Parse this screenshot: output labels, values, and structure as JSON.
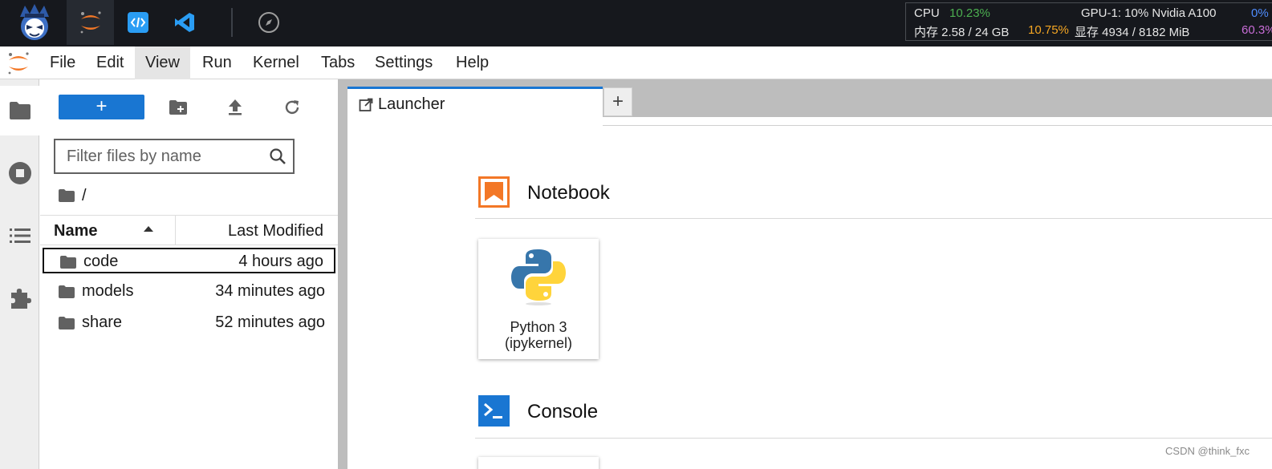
{
  "topbar": {
    "apps": [
      {
        "name": "user-avatar"
      },
      {
        "name": "jupyter-app"
      },
      {
        "name": "code-server-app"
      },
      {
        "name": "vscode-app"
      },
      {
        "name": "compass-app"
      }
    ]
  },
  "sysmon": {
    "cpu_label": "CPU",
    "cpu_value": "10.23%",
    "mem_label": "内存 2.58 / 24 GB",
    "mem_value": "10.75%",
    "gpu_label": "GPU-1: 10% Nvidia A100",
    "gpu_value": "0%",
    "vram_label": "显存 4934 / 8182 MiB",
    "vram_value": "60.3%",
    "colors": {
      "cpu": "#4caf50",
      "mem": "#f5a623",
      "gpu": "#4f8dff",
      "vram": "#c86dd7"
    }
  },
  "menubar": {
    "items": [
      "File",
      "Edit",
      "View",
      "Run",
      "Kernel",
      "Tabs",
      "Settings",
      "Help"
    ],
    "active": "View"
  },
  "leftrail": {
    "items": [
      "folder-icon",
      "stop-circle-icon",
      "list-icon",
      "puzzle-icon"
    ]
  },
  "filebrowser": {
    "new_label": "+",
    "filter_placeholder": "Filter files by name",
    "breadcrumb": "/",
    "columns": {
      "name": "Name",
      "modified": "Last Modified"
    },
    "rows": [
      {
        "name": "code",
        "modified": "4 hours ago"
      },
      {
        "name": "models",
        "modified": "34 minutes ago"
      },
      {
        "name": "share",
        "modified": "52 minutes ago"
      }
    ]
  },
  "tabs": {
    "items": [
      {
        "label": "Launcher"
      }
    ],
    "add_label": "+"
  },
  "launcher": {
    "sections": [
      {
        "title": "Notebook",
        "color": "#f37726"
      },
      {
        "title": "Console",
        "color": "#1976d2"
      }
    ],
    "kernel_card": {
      "label": "Python 3\n(ipykernel)"
    }
  },
  "watermark": "CSDN @think_fxc",
  "colors": {
    "accent": "#1976d2",
    "jupyter_orange": "#f37726"
  }
}
